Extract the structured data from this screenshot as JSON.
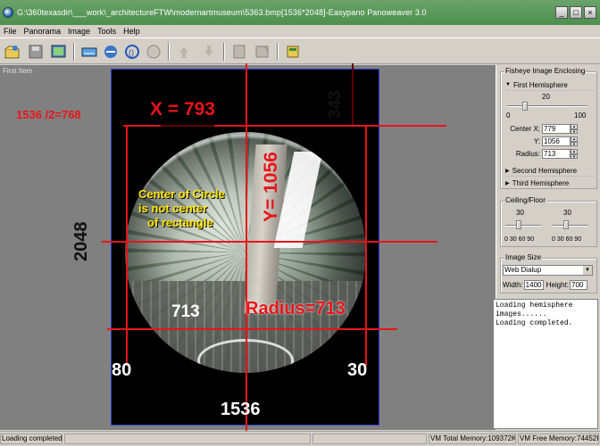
{
  "window": {
    "title": "G:\\360texasdir\\___work\\_architectureFTW\\modernartmuseum\\5363.bmp[1536*2048]-Easypano Panoweaver 3.0",
    "minimize": "_",
    "maximize": "□",
    "close": "×"
  },
  "menu": [
    "File",
    "Panorama",
    "Image",
    "Tools",
    "Help"
  ],
  "toolbar": {
    "icons": [
      "open-icon",
      "save-icon",
      "import-icon",
      "stitch-icon",
      "blend-icon",
      "auto-icon",
      "undo-icon",
      "redo-icon",
      "publish-icon",
      "export-icon",
      "help-book-icon"
    ]
  },
  "viewer": {
    "caption": "First Item"
  },
  "annotations": {
    "half_width": "1536 /2=768",
    "x_label": "X = 793",
    "top_offset": "343",
    "y_label": "Y= 1056",
    "height_label": "2048",
    "note": [
      "Center of Circle",
      "is not center",
      "of rectangle"
    ],
    "radius_left": "713",
    "radius_label": "Radius=713",
    "left_margin": "80",
    "right_margin": "30",
    "width_label": "1536"
  },
  "right_panel": {
    "enclosing": {
      "title": "Fisheye Image Enclosing",
      "first": "First Hemisphere",
      "slider_value": "20",
      "slider_min": "0",
      "slider_max": "100",
      "center_x_label": "Center X:",
      "center_x": "779",
      "y_label": "Y:",
      "y": "1056",
      "radius_label": "Radius:",
      "radius": "713",
      "second": "Second Hemisphere",
      "third": "Third Hemisphere"
    },
    "ceiling": {
      "title": "Ceiling/Floor",
      "left_value": "30",
      "right_value": "30",
      "ticks": "0 30 60 90"
    },
    "image_size": {
      "title": "Image Size",
      "preset": "Web Dialup",
      "width_label": "Width:",
      "width": "1400",
      "height_label": "Height:",
      "height": "700"
    },
    "log": [
      "Loading hemisphere",
      "images......",
      "Loading completed."
    ]
  },
  "statusbar": {
    "message": "Loading completed.",
    "vm_total": "VM Total Memory:109372K",
    "vm_free": "VM Free Memory:74452K"
  },
  "colors": {
    "annotation_red": "#e8141a",
    "frame_blue": "#2b3fd0",
    "note_yellow": "#ffe600",
    "titlebar_green": "#4d8f4d"
  }
}
